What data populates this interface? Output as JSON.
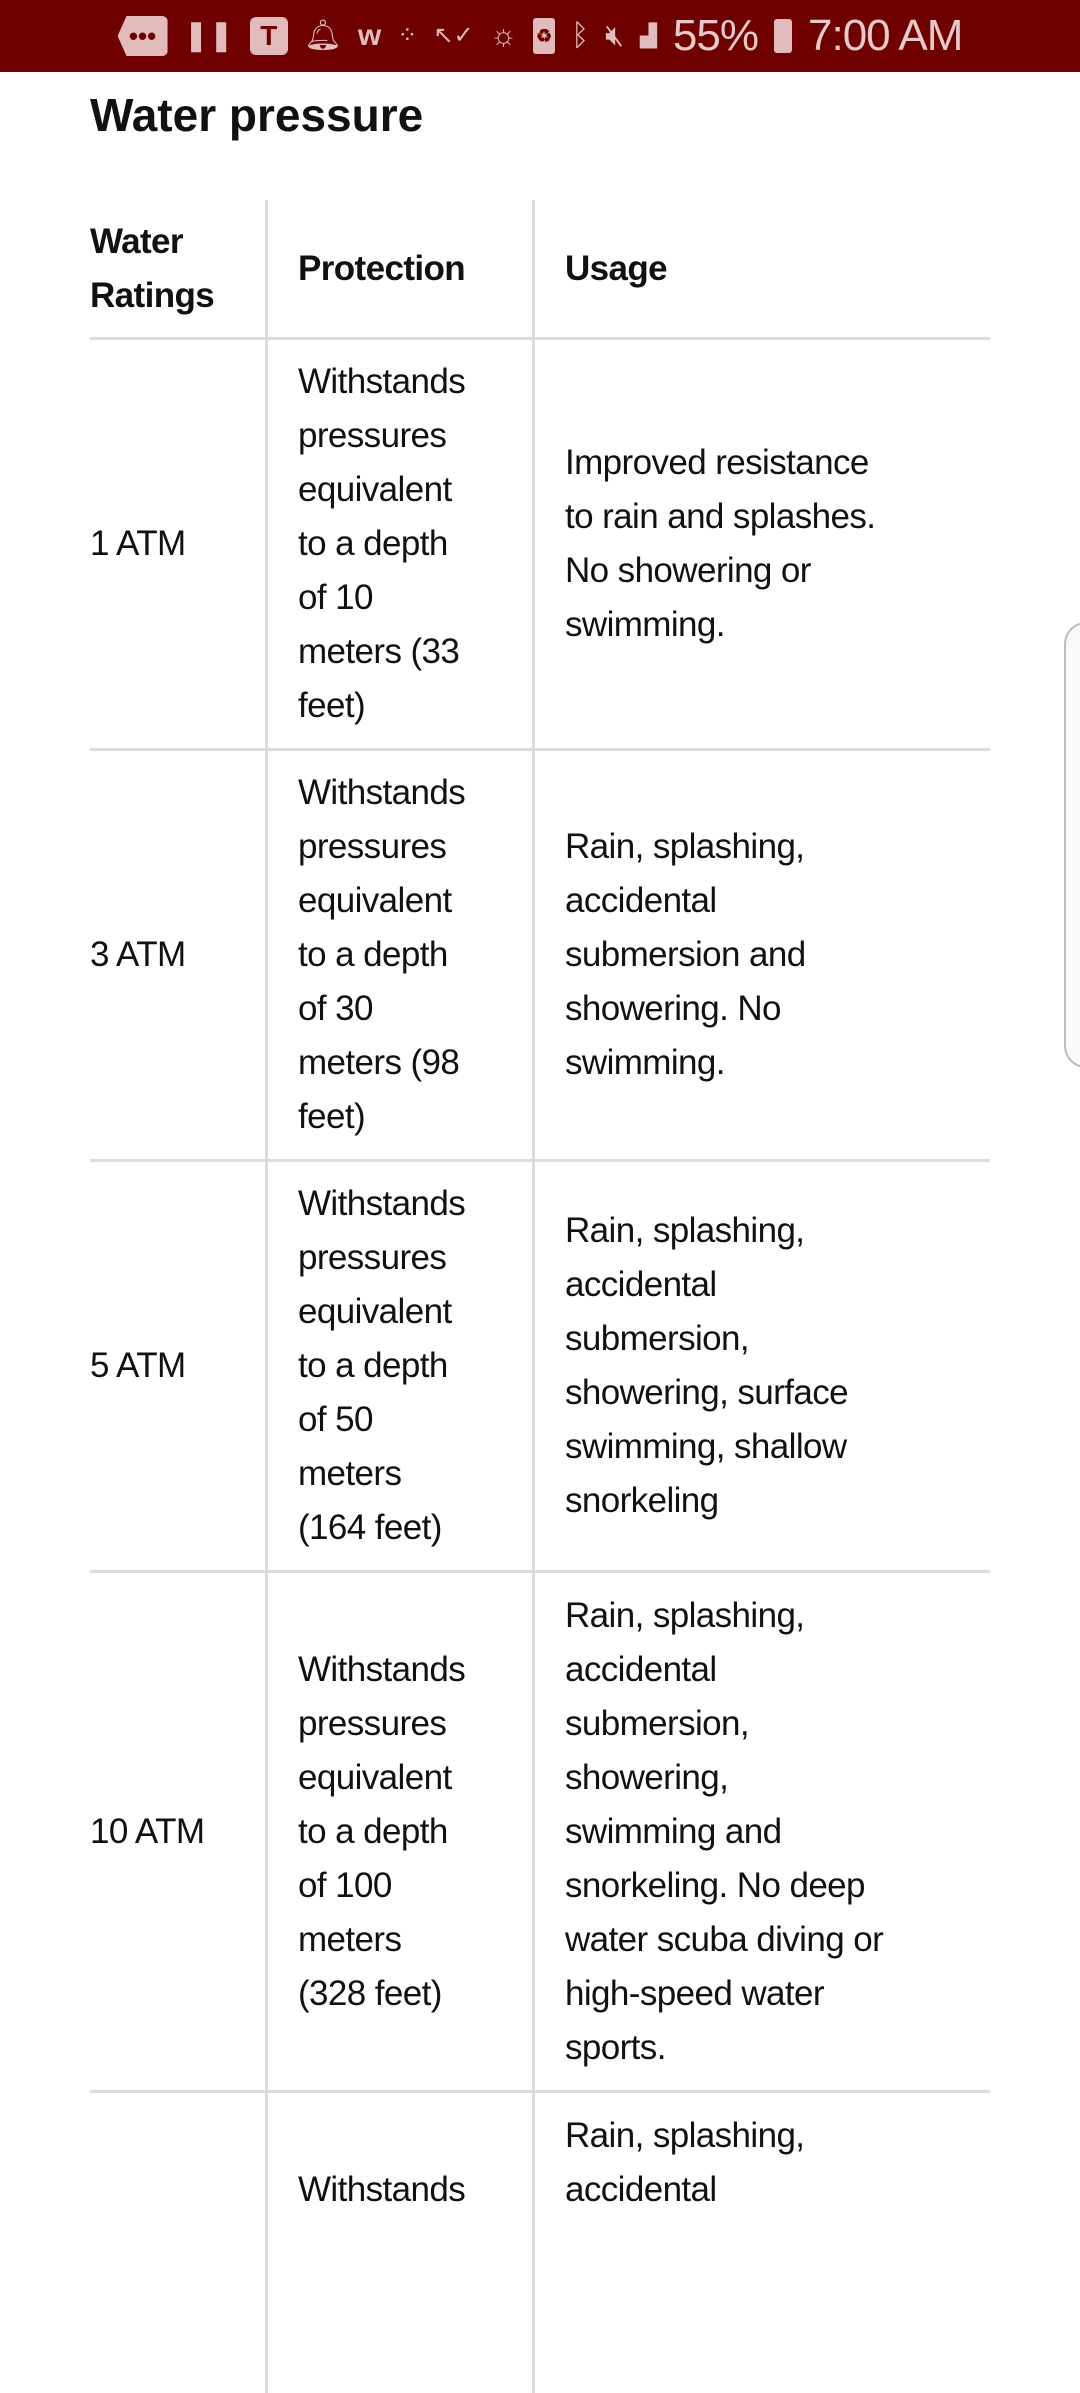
{
  "status_bar": {
    "icons": [
      "more-icon",
      "pause-icon",
      "t-app-icon",
      "bell-icon",
      "w-app-icon",
      "fitbit-icon",
      "check-arrow-icon",
      "weather-icon",
      "battery-saver-icon",
      "bluetooth-icon",
      "mute-icon",
      "lte-signal-icon"
    ],
    "battery": "55%",
    "time": "7:00 AM",
    "background_color": "#6f0000"
  },
  "page": {
    "heading": "Water pressure"
  },
  "table": {
    "headers": [
      [
        "Water",
        "Ratings"
      ],
      [
        "Protection"
      ],
      [
        "Usage"
      ]
    ],
    "rows": [
      {
        "rating": [
          "1 ATM"
        ],
        "protection": [
          "Withstands",
          "pressures",
          "equivalent",
          "to a depth",
          "of 10",
          "meters (33",
          "feet)"
        ],
        "usage": [
          "Improved resistance",
          "to rain and splashes.",
          "No showering or",
          "swimming."
        ]
      },
      {
        "rating": [
          "3 ATM"
        ],
        "protection": [
          "Withstands",
          "pressures",
          "equivalent",
          "to a depth",
          "of 30",
          "meters (98",
          "feet)"
        ],
        "usage": [
          "Rain, splashing,",
          "accidental",
          "submersion and",
          "showering. No",
          "swimming."
        ]
      },
      {
        "rating": [
          "5 ATM"
        ],
        "protection": [
          "Withstands",
          "pressures",
          "equivalent",
          "to a depth",
          "of 50",
          "meters",
          "(164 feet)"
        ],
        "usage": [
          "Rain, splashing,",
          "accidental",
          "submersion,",
          "showering, surface",
          "swimming, shallow",
          "snorkeling"
        ]
      },
      {
        "rating": [
          "10 ATM"
        ],
        "protection": [
          "Withstands",
          "pressures",
          "equivalent",
          "to a depth",
          "of 100",
          "meters",
          "(328 feet)"
        ],
        "usage": [
          "Rain, splashing,",
          "accidental",
          "submersion,",
          "showering,",
          "swimming and",
          "snorkeling. No deep",
          "water scuba diving or",
          "high-speed water",
          "sports."
        ]
      },
      {
        "rating": [],
        "protection": [
          "Withstands"
        ],
        "usage": [
          "Rain, splashing,",
          "accidental"
        ]
      }
    ]
  }
}
